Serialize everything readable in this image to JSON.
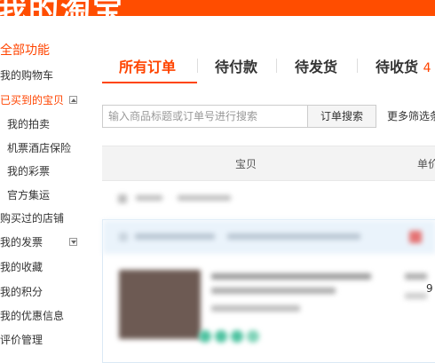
{
  "header": {
    "brand_text": "我的淘宝"
  },
  "sidebar": {
    "title": "全部功能",
    "items": [
      {
        "label": "我的购物车",
        "level": "top"
      },
      {
        "label": "已买到的宝贝",
        "level": "top",
        "active": true,
        "toggle": "collapse"
      },
      {
        "label": "我的拍卖",
        "level": "sub"
      },
      {
        "label": "机票酒店保险",
        "level": "sub"
      },
      {
        "label": "我的彩票",
        "level": "sub"
      },
      {
        "label": "官方集运",
        "level": "sub"
      },
      {
        "label": "购买过的店铺",
        "level": "top"
      },
      {
        "label": "我的发票",
        "level": "top",
        "toggle": "expand"
      },
      {
        "label": "我的收藏",
        "level": "top"
      },
      {
        "label": "我的积分",
        "level": "top"
      },
      {
        "label": "我的优惠信息",
        "level": "top"
      },
      {
        "label": "评价管理",
        "level": "top"
      }
    ]
  },
  "tabs": [
    {
      "label": "所有订单",
      "active": true
    },
    {
      "label": "待付款"
    },
    {
      "label": "待发货"
    },
    {
      "label": "待收货",
      "count": "4"
    }
  ],
  "search": {
    "placeholder": "输入商品标题或订单号进行搜索",
    "value": "",
    "button_label": "订单搜索",
    "more_filters_label": "更多筛选条"
  },
  "table_header": {
    "col_item": "宝贝",
    "col_price": "单价"
  },
  "orders": [
    {
      "partial_text": "9"
    }
  ],
  "colors": {
    "accent": "#ff4400",
    "header_bg": "#ff4d00",
    "table_header_bg": "#f3f3f3",
    "order_head_bg": "#eaf3fb"
  }
}
